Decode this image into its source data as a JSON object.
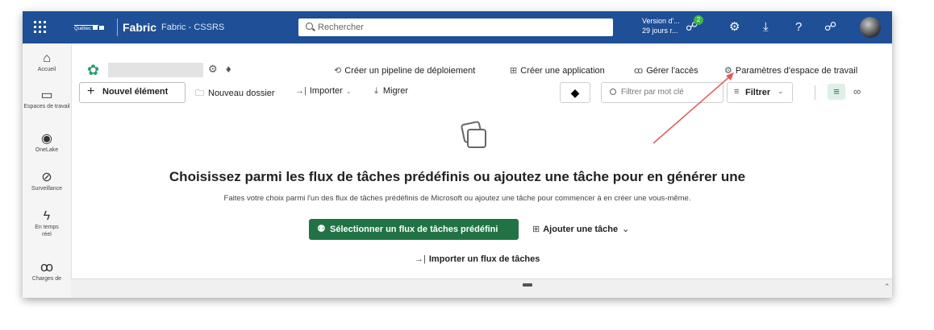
{
  "colors": {
    "topbar": "#1f4f96",
    "accent": "#217346",
    "annotation": "#e05a5a"
  },
  "topbar": {
    "logo_text": "Québec",
    "brand": "Fabric",
    "workspace": "Fabric - CSSRS",
    "search_placeholder": "Rechercher",
    "trial_line1": "Version d'...",
    "trial_line2": "29 jours r...",
    "notif_count": "2",
    "icons": [
      "waffle-icon",
      "rocket-icon",
      "gear-icon",
      "download-icon",
      "help-icon",
      "share-icon"
    ]
  },
  "rail": {
    "items": [
      {
        "label": "Accueil",
        "icon": "⌂"
      },
      {
        "label": "Espaces de travail",
        "icon": "▭"
      },
      {
        "label": "OneLake",
        "icon": "◉"
      },
      {
        "label": "Surveillance",
        "icon": "⊘"
      },
      {
        "label": "En temps réel",
        "icon": "ϟ"
      },
      {
        "label": "Charges de",
        "icon": "ꝏ"
      }
    ]
  },
  "workspace_header": {
    "actions": [
      {
        "icon": "⟲",
        "label": "Créer un pipeline de déploiement"
      },
      {
        "icon": "⊞",
        "label": "Créer une application"
      },
      {
        "icon": "ꝏ",
        "label": "Gérer l'accès"
      },
      {
        "icon": "⚙",
        "label": "Paramètres d'espace de travail"
      }
    ]
  },
  "toolbar": {
    "new_item": "Nouvel élément",
    "new_folder": "Nouveau dossier",
    "import": "Importer",
    "migrate": "Migrer",
    "filter_placeholder": "Filtrer par mot clé",
    "filter": "Filtrer"
  },
  "empty_state": {
    "title": "Choisissez parmi les flux de tâches prédéfinis ou ajoutez une tâche pour en générer une",
    "subtitle": "Faites votre choix parmi l'un des flux de tâches prédéfinis de Microsoft ou ajoutez une tâche pour commencer à en créer une vous-même.",
    "primary_button": "Sélectionner un flux de tâches prédéfini",
    "add_task": "Ajouter une tâche",
    "import_flow": "Importer un flux de tâches"
  }
}
